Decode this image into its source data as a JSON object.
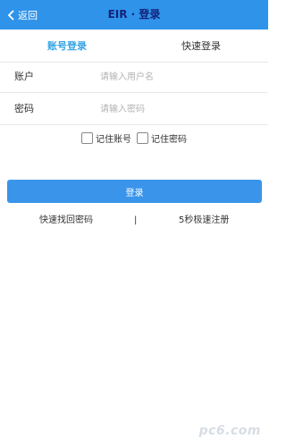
{
  "header": {
    "back_label": "返回",
    "title": "EIR · 登录"
  },
  "tabs": [
    {
      "label": "账号登录",
      "active": true
    },
    {
      "label": "快速登录",
      "active": false
    }
  ],
  "form": {
    "account": {
      "label": "账户",
      "placeholder": "请输入用户名",
      "value": ""
    },
    "password": {
      "label": "密码",
      "placeholder": "请输入密码",
      "value": ""
    },
    "remember_account": {
      "label": "记住账号",
      "checked": false
    },
    "remember_password": {
      "label": "记住密码",
      "checked": false
    },
    "submit_label": "登录"
  },
  "links": {
    "forgot": "快速找回密码",
    "separator": "|",
    "register": "5秒极速注册"
  },
  "watermark": "pc6.com",
  "colors": {
    "header_bg": "#2f93ea",
    "title": "#13237a",
    "active_tab": "#35a4e4",
    "button_bg": "#3a95ea"
  }
}
